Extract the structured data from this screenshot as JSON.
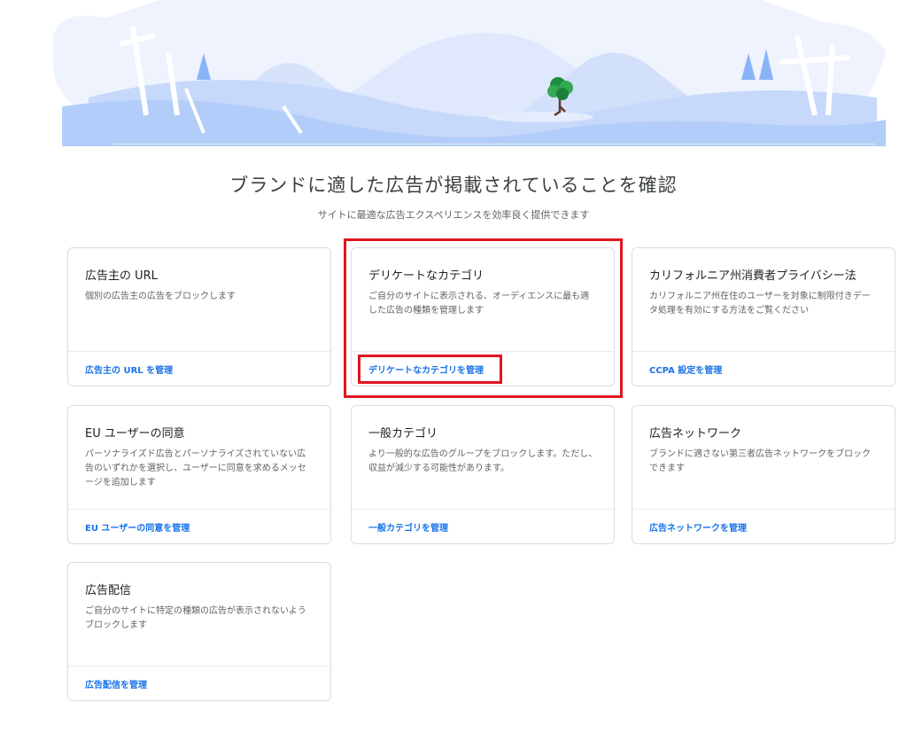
{
  "header": {
    "title": "ブランドに適した広告が掲載されていることを確認",
    "subtitle": "サイトに最適な広告エクスペリエンスを効率良く提供できます"
  },
  "cards": [
    {
      "title": "広告主の URL",
      "description": "個別の広告主の広告をブロックします",
      "link": "広告主の URL を管理"
    },
    {
      "title": "デリケートなカテゴリ",
      "description": "ご自分のサイトに表示される、オーディエンスに最も適した広告の種類を管理します",
      "link": "デリケートなカテゴリを管理"
    },
    {
      "title": "カリフォルニア州消費者プライバシー法",
      "description": "カリフォルニア州在住のユーザーを対象に制限付きデータ処理を有効にする方法をご覧ください",
      "link": "CCPA 設定を管理"
    },
    {
      "title": "EU ユーザーの同意",
      "description": "パーソナライズド広告とパーソナライズされていない広告のいずれかを選択し、ユーザーに同意を求めるメッセージを追加します",
      "link": "EU ユーザーの同意を管理"
    },
    {
      "title": "一般カテゴリ",
      "description": "より一般的な広告のグループをブロックします。ただし、収益が減少する可能性があります。",
      "link": "一般カテゴリを管理"
    },
    {
      "title": "広告ネットワーク",
      "description": "ブランドに適さない第三者広告ネットワークをブロックできます",
      "link": "広告ネットワークを管理"
    },
    {
      "title": "広告配信",
      "description": "ご自分のサイトに特定の種類の広告が表示されないようブロックします",
      "link": "広告配信を管理"
    }
  ],
  "colors": {
    "accent": "#1a73e8",
    "highlight": "#e0141e",
    "illustration_sky": "#e8eefc",
    "illustration_hill": "#aecbfa"
  },
  "icons": {
    "hero": "landscape-illustration",
    "tree": "tree-icon"
  }
}
